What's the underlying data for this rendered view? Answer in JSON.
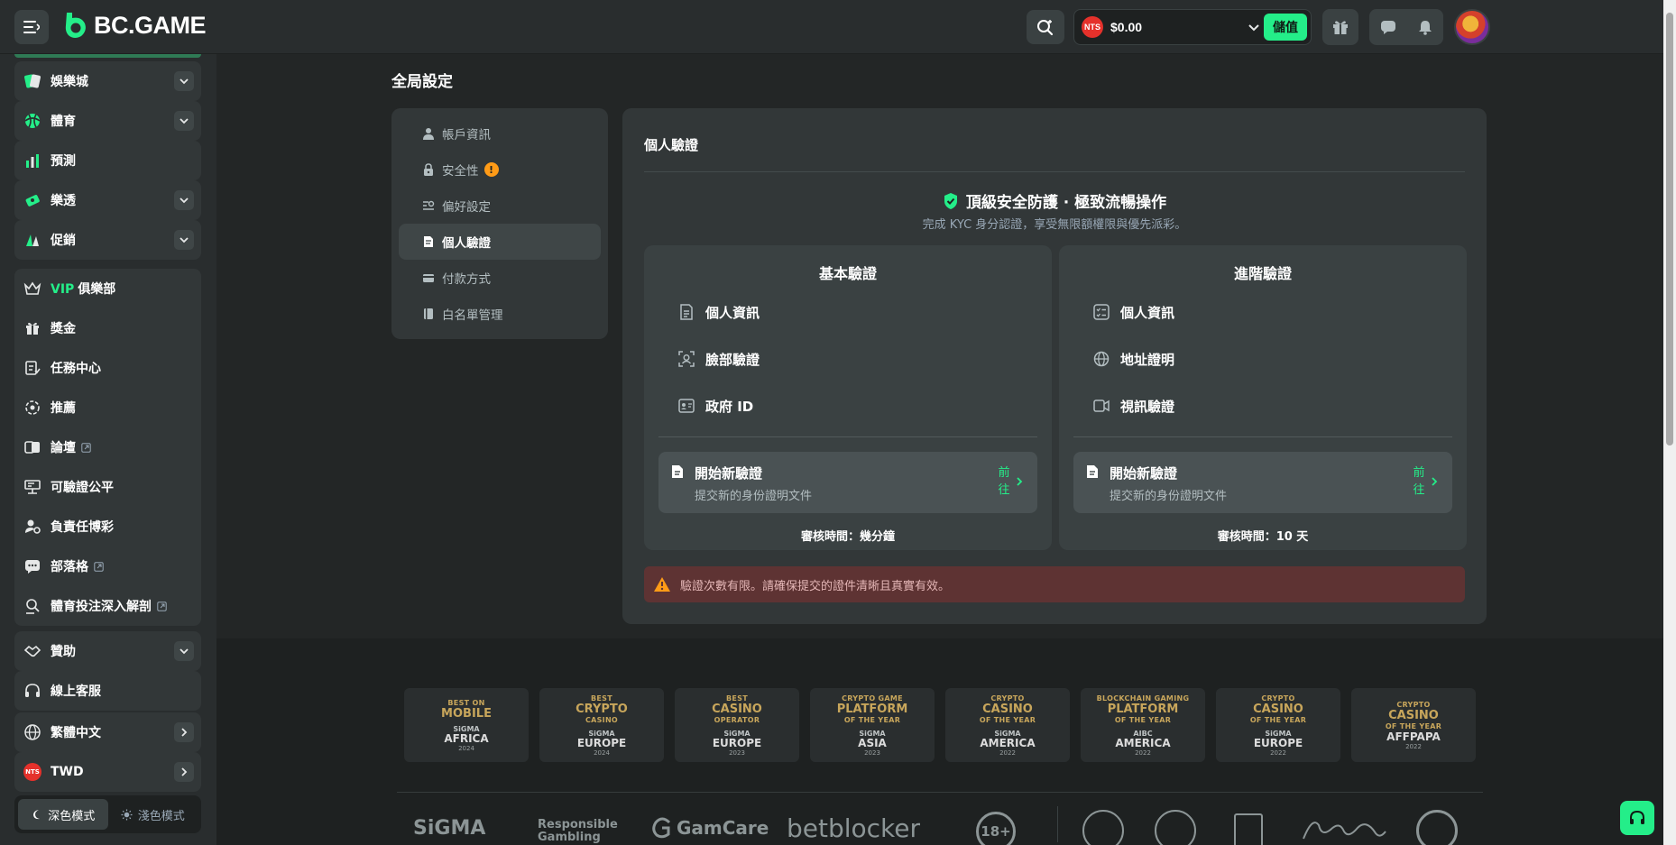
{
  "header": {
    "logo_text": "BC.GAME",
    "currency_badge": "NTS",
    "balance": "$0.00",
    "deposit_label": "儲值"
  },
  "sidebar": {
    "groups": [
      {
        "label": "娛樂城",
        "icon": "casino-icon"
      },
      {
        "label": "體育",
        "icon": "sports-icon"
      },
      {
        "label": "預測",
        "icon": "prediction-icon"
      },
      {
        "label": "樂透",
        "icon": "lottery-icon"
      },
      {
        "label": "促銷",
        "icon": "promotion-icon"
      }
    ],
    "menu": [
      {
        "vip": "VIP",
        "label": "俱樂部",
        "icon": "crown-icon"
      },
      {
        "label": "獎金",
        "icon": "gift-icon"
      },
      {
        "label": "任務中心",
        "icon": "task-icon"
      },
      {
        "label": "推薦",
        "icon": "referral-icon"
      },
      {
        "label": "論壇",
        "icon": "forum-icon"
      },
      {
        "label": "可驗證公平",
        "icon": "fairness-icon"
      },
      {
        "label": "負責任博彩",
        "icon": "responsible-icon"
      },
      {
        "label": "部落格",
        "icon": "blog-icon"
      },
      {
        "label": "體育投注深入解剖",
        "icon": "analysis-icon"
      }
    ],
    "sponsor": "贊助",
    "support": "線上客服",
    "language": "繁體中文",
    "currency": "TWD",
    "currency_badge": "NTS",
    "theme_dark": "深色模式",
    "theme_light": "淺色模式"
  },
  "page": {
    "title": "全局設定",
    "nav": [
      {
        "label": "帳戶資訊"
      },
      {
        "label": "安全性",
        "badge": "!"
      },
      {
        "label": "偏好設定"
      },
      {
        "label": "個人驗證"
      },
      {
        "label": "付款方式"
      },
      {
        "label": "白名單管理"
      }
    ]
  },
  "kyc": {
    "title": "個人驗證",
    "headline": "頂級安全防護 · 極致流暢操作",
    "subtitle": "完成 KYC 身分認證，享受無限額權限與優先派彩。",
    "basic": {
      "title": "基本驗證",
      "items": [
        "個人資訊",
        "臉部驗證",
        "政府 ID"
      ],
      "start_title": "開始新驗證",
      "start_desc": "提交新的身份證明文件",
      "go": "前往",
      "review": "審核時間：幾分鐘"
    },
    "advanced": {
      "title": "進階驗證",
      "items": [
        "個人資訊",
        "地址證明",
        "視訊驗證"
      ],
      "start_title": "開始新驗證",
      "start_desc": "提交新的身份證明文件",
      "go": "前往",
      "review": "審核時間：10 天"
    },
    "warning": "驗證次數有限。請確保提交的證件清晰且真實有效。"
  },
  "footer": {
    "awards": [
      {
        "top": "BEST ON",
        "big": "MOBILE",
        "org": "SiGMA",
        "region": "AFRICA",
        "year": "2024"
      },
      {
        "top": "BEST",
        "big": "CRYPTO",
        "sub": "CASINO",
        "org": "SiGMA",
        "region": "EUROPE",
        "year": "2024"
      },
      {
        "top": "BEST",
        "big": "CASINO",
        "sub": "OPERATOR",
        "org": "SiGMA",
        "region": "EUROPE",
        "year": "2023"
      },
      {
        "top": "CRYPTO GAME",
        "big": "PLATFORM",
        "sub": "OF THE YEAR",
        "org": "SiGMA",
        "region": "ASIA",
        "year": "2023"
      },
      {
        "top": "CRYPTO",
        "big": "CASINO",
        "sub": "OF THE YEAR",
        "org": "SiGMA",
        "region": "AMERICA",
        "year": "2022"
      },
      {
        "top": "BLOCKCHAIN GAMING",
        "big": "PLATFORM",
        "sub": "OF THE YEAR",
        "org": "AIBC",
        "region": "AMERICA",
        "year": "2022"
      },
      {
        "top": "CRYPTO",
        "big": "CASINO",
        "sub": "OF THE YEAR",
        "org": "SiGMA",
        "region": "EUROPE",
        "year": "2022"
      },
      {
        "top": "CRYPTO",
        "big": "CASINO",
        "sub": "OF THE YEAR",
        "org": "",
        "region": "AFFPAPA",
        "year": "2022"
      }
    ],
    "partners": [
      "SiGMA",
      "Responsible Gambling",
      "GamCare",
      "betblocker",
      "18+"
    ]
  },
  "colors": {
    "accent": "#24ee89",
    "background": "#232626",
    "panel": "#323738",
    "warning_bg": "#5e3333",
    "badge_red": "#e5312b",
    "alert_orange": "#ff9b17"
  }
}
